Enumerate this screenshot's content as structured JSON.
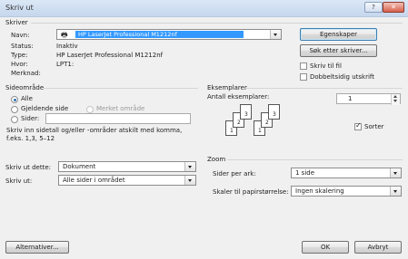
{
  "window": {
    "title": "Skriv ut",
    "help": "?",
    "close": "✕"
  },
  "printer": {
    "section": "Skriver",
    "name_label": "Navn:",
    "name_value": "HP LaserJet Professional M1212nf",
    "status_label": "Status:",
    "status_value": "Inaktiv",
    "type_label": "Type:",
    "type_value": "HP LaserJet Professional M1212nf",
    "where_label": "Hvor:",
    "where_value": "LPT1:",
    "comment_label": "Merknad:",
    "properties_button": "Egenskaper",
    "find_button": "Søk etter skriver...",
    "print_to_file": "Skriv til fil",
    "duplex": "Dobbeltsidig utskrift"
  },
  "range": {
    "section": "Sideområde",
    "all": "Alle",
    "current": "Gjeldende side",
    "selection": "Merket område",
    "pages": "Sider:",
    "hint": "Skriv inn sidetall og/eller -områder atskilt med komma, f.eks. 1,3, 5–12"
  },
  "copies": {
    "section": "Eksemplarer",
    "count_label": "Antall eksemplarer:",
    "count_value": "1",
    "collate": "Sorter",
    "pages_icons": [
      "1",
      "2",
      "3",
      "1",
      "2",
      "3"
    ]
  },
  "print_what": {
    "label": "Skriv ut dette:",
    "value": "Dokument"
  },
  "print": {
    "label": "Skriv ut:",
    "value": "Alle sider i området"
  },
  "zoom": {
    "section": "Zoom",
    "per_sheet_label": "Sider per ark:",
    "per_sheet_value": "1 side",
    "scale_label": "Skaler til papirstørrelse:",
    "scale_value": "Ingen skalering"
  },
  "footer": {
    "options": "Alternativer...",
    "ok": "OK",
    "cancel": "Avbryt"
  }
}
